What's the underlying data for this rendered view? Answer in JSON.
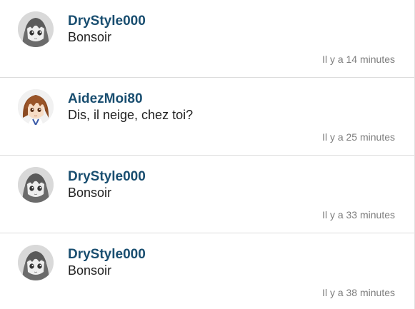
{
  "messages": [
    {
      "user": "DryStyle000",
      "text": "Bonsoir",
      "time": "Il y a 14 minutes",
      "avatar": "gray-anime-avatar"
    },
    {
      "user": "AidezMoi80",
      "text": "Dis, il neige, chez toi?",
      "time": "Il y a 25 minutes",
      "avatar": "brown-hair-anime-avatar"
    },
    {
      "user": "DryStyle000",
      "text": "Bonsoir",
      "time": "Il y a 33 minutes",
      "avatar": "gray-anime-avatar"
    },
    {
      "user": "DryStyle000",
      "text": "Bonsoir",
      "time": "Il y a 38 minutes",
      "avatar": "gray-anime-avatar"
    }
  ],
  "colors": {
    "username": "#194e70",
    "text": "#222222",
    "time": "#7c7c7c",
    "divider": "#dcdcdc"
  }
}
